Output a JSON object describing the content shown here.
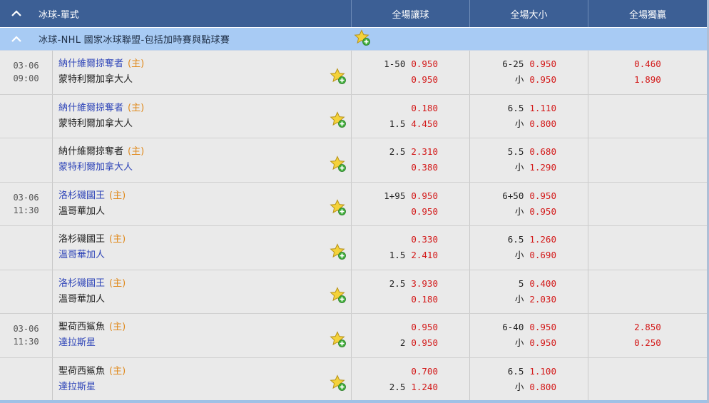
{
  "header": {
    "title": "冰球-單式",
    "col_handicap": "全場讓球",
    "col_overunder": "全場大小",
    "col_1x2": "全場獨贏"
  },
  "league": {
    "name": "冰球-NHL 國家冰球聯盟-包括加時賽與點球賽"
  },
  "home_tag": "(主)",
  "rows": [
    {
      "date": "03-06",
      "time": "09:00",
      "t1": "納什維爾掠奪者",
      "t2": "蒙特利爾加拿大人",
      "hc1": "1-50",
      "hc1o": "0.950",
      "hc2": "",
      "hc2o": "0.950",
      "ou1": "6-25",
      "ou1o": "0.950",
      "ou2": "小",
      "ou2o": "0.950",
      "x1": "0.460",
      "x2": "1.890"
    },
    {
      "date": "",
      "time": "",
      "t1": "納什維爾掠奪者",
      "t2": "蒙特利爾加拿大人",
      "hc1": "",
      "hc1o": "0.180",
      "hc2": "1.5",
      "hc2o": "4.450",
      "ou1": "6.5",
      "ou1o": "1.110",
      "ou2": "小",
      "ou2o": "0.800",
      "x1": "",
      "x2": ""
    },
    {
      "date": "",
      "time": "",
      "t1": "納什維爾掠奪者",
      "t2": "蒙特利爾加拿大人",
      "hc1": "2.5",
      "hc1o": "2.310",
      "hc2": "",
      "hc2o": "0.380",
      "ou1": "5.5",
      "ou1o": "0.680",
      "ou2": "小",
      "ou2o": "1.290",
      "x1": "",
      "x2": ""
    },
    {
      "date": "03-06",
      "time": "11:30",
      "t1": "洛杉磯國王",
      "t2": "溫哥華加人",
      "hc1": "1+95",
      "hc1o": "0.950",
      "hc2": "",
      "hc2o": "0.950",
      "ou1": "6+50",
      "ou1o": "0.950",
      "ou2": "小",
      "ou2o": "0.950",
      "x1": "",
      "x2": ""
    },
    {
      "date": "",
      "time": "",
      "t1": "洛杉磯國王",
      "t2": "溫哥華加人",
      "hc1": "",
      "hc1o": "0.330",
      "hc2": "1.5",
      "hc2o": "2.410",
      "ou1": "6.5",
      "ou1o": "1.260",
      "ou2": "小",
      "ou2o": "0.690",
      "x1": "",
      "x2": ""
    },
    {
      "date": "",
      "time": "",
      "t1": "洛杉磯國王",
      "t2": "溫哥華加人",
      "hc1": "2.5",
      "hc1o": "3.930",
      "hc2": "",
      "hc2o": "0.180",
      "ou1": "5",
      "ou1o": "0.400",
      "ou2": "小",
      "ou2o": "2.030",
      "x1": "",
      "x2": ""
    },
    {
      "date": "03-06",
      "time": "11:30",
      "t1": "聖荷西鯊魚",
      "t2": "達拉斯星",
      "hc1": "",
      "hc1o": "0.950",
      "hc2": "2",
      "hc2o": "0.950",
      "ou1": "6-40",
      "ou1o": "0.950",
      "ou2": "小",
      "ou2o": "0.950",
      "x1": "2.850",
      "x2": "0.250"
    },
    {
      "date": "",
      "time": "",
      "t1": "聖荷西鯊魚",
      "t2": "達拉斯星",
      "hc1": "",
      "hc1o": "0.700",
      "hc2": "2.5",
      "hc2o": "1.240",
      "ou1": "6.5",
      "ou1o": "1.100",
      "ou2": "小",
      "ou2o": "0.800",
      "x1": "",
      "x2": ""
    }
  ],
  "favorite_team": [
    1,
    1,
    2,
    1,
    2,
    1,
    2,
    2
  ],
  "colors": {
    "header_bg": "#3c5f95",
    "league_bg": "#a8cbf4",
    "odds": "#d31818",
    "favorite": "#2f45b8",
    "home": "#e08a1e"
  }
}
